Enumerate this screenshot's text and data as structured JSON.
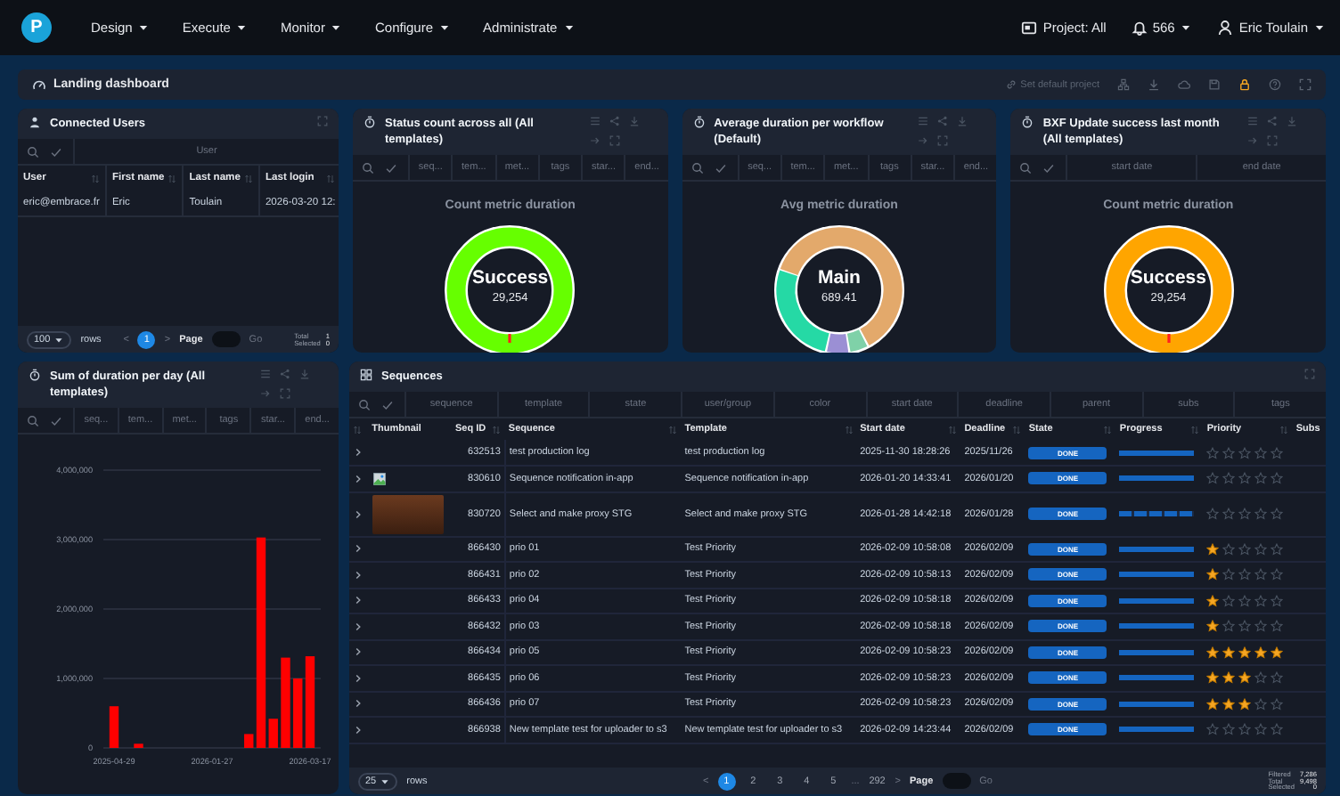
{
  "nav": {
    "logo": "P",
    "menus": [
      {
        "label": "Design"
      },
      {
        "label": "Execute"
      },
      {
        "label": "Monitor"
      },
      {
        "label": "Configure"
      },
      {
        "label": "Administrate"
      }
    ],
    "project": "Project: All",
    "notifications": "566",
    "user": "Eric Toulain"
  },
  "dashboard": {
    "title": "Landing dashboard",
    "set_default": "Set default project"
  },
  "connected_users": {
    "title": "Connected Users",
    "filters": [
      "User"
    ],
    "columns": [
      "User",
      "First name",
      "Last name",
      "Last login"
    ],
    "rows": [
      [
        "eric@embrace.fr",
        "Eric",
        "Toulain",
        "2026-03-20 12:"
      ]
    ],
    "footer": {
      "rows_per_page": "100",
      "rows_label": "rows",
      "prev": "<",
      "pages": [
        {
          "label": "1",
          "selected": true
        }
      ],
      "next": ">",
      "page_label": "Page",
      "go": "Go",
      "totals": [
        {
          "label": "Total",
          "value": "1"
        },
        {
          "label": "Selected",
          "value": "0"
        }
      ]
    }
  },
  "donut_widgets": [
    {
      "title": "Status count across all (All templates)",
      "filters": [
        "seq...",
        "tem...",
        "met...",
        "tags",
        "star...",
        "end..."
      ],
      "chart_title": "Count metric duration",
      "center_label": "Success",
      "center_value": "29,254",
      "kind": "single",
      "color": "#66ff00"
    },
    {
      "title": "Average duration per workflow (Default)",
      "filters": [
        "seq...",
        "tem...",
        "met...",
        "tags",
        "star...",
        "end..."
      ],
      "chart_title": "Avg metric duration",
      "center_label": "Main",
      "center_value": "689.41",
      "kind": "multi"
    },
    {
      "title": "BXF Update success last month (All templates)",
      "filters": [
        "start date",
        "end date"
      ],
      "chart_title": "Count metric duration",
      "center_label": "Success",
      "center_value": "29,254",
      "kind": "single",
      "color": "#ffa500"
    }
  ],
  "sum_widget": {
    "title": "Sum of duration per day (All templates)",
    "filters": [
      "seq...",
      "tem...",
      "met...",
      "tags",
      "star...",
      "end..."
    ],
    "chart_data": {
      "type": "bar",
      "categories": [
        "2025-04-29",
        null,
        null,
        null,
        null,
        null,
        null,
        null,
        "2026-01-27",
        null,
        null,
        null,
        null,
        null,
        null,
        null,
        "2026-03-17"
      ],
      "series": [
        {
          "color": "#ff0000",
          "values": [
            600000,
            null,
            60000,
            null,
            null,
            null,
            null,
            null,
            null,
            null,
            null,
            200000,
            3030000,
            420000,
            1300000,
            1000000,
            1320000
          ]
        }
      ],
      "ylim": [
        0,
        4000000
      ],
      "grid": true,
      "yticks": [
        {
          "value": 0,
          "label": "0"
        },
        {
          "value": 1000000,
          "label": "1,000,000"
        },
        {
          "value": 2000000,
          "label": "2,000,000"
        },
        {
          "value": 3000000,
          "label": "3,000,000"
        },
        {
          "value": 4000000,
          "label": "4,000,000"
        }
      ]
    }
  },
  "sequences": {
    "title": "Sequences",
    "filters": [
      "sequence",
      "template",
      "state",
      "user/group",
      "color",
      "start date",
      "deadline",
      "parent",
      "subs",
      "tags"
    ],
    "columns": [
      "Thumbnail",
      "Seq ID",
      "Sequence",
      "Template",
      "Start date",
      "Deadline",
      "State",
      "Progress",
      "Priority",
      "Subs"
    ],
    "rows": [
      {
        "thumbnail": {
          "kind": "none"
        },
        "seq_id": "632513",
        "sequence": "test production log",
        "template": "test production log",
        "start_date": "2025-11-30 18:28:26",
        "deadline": "2025/11/26",
        "state": "DONE",
        "progress": {
          "level": 1,
          "segmented": false
        },
        "stars": 0
      },
      {
        "thumbnail": {
          "kind": "broken"
        },
        "seq_id": "830610",
        "sequence": "Sequence notification in-app",
        "template": "Sequence notification in-app",
        "start_date": "2026-01-20 14:33:41",
        "deadline": "2026/01/20",
        "state": "DONE",
        "progress": {
          "level": 1,
          "segmented": false
        },
        "stars": 0
      },
      {
        "thumbnail": {
          "kind": "photo"
        },
        "seq_id": "830720",
        "sequence": "Select and make proxy STG",
        "template": "Select and make proxy STG",
        "start_date": "2026-01-28 14:42:18",
        "deadline": "2026/01/28",
        "state": "DONE",
        "progress": {
          "level": 1,
          "segmented": true
        },
        "stars": 0
      },
      {
        "thumbnail": {
          "kind": "none"
        },
        "seq_id": "866430",
        "sequence": "prio 01",
        "template": "Test Priority",
        "start_date": "2026-02-09 10:58:08",
        "deadline": "2026/02/09",
        "state": "DONE",
        "progress": {
          "level": 1,
          "segmented": false
        },
        "stars": 1
      },
      {
        "thumbnail": {
          "kind": "none"
        },
        "seq_id": "866431",
        "sequence": "prio 02",
        "template": "Test Priority",
        "start_date": "2026-02-09 10:58:13",
        "deadline": "2026/02/09",
        "state": "DONE",
        "progress": {
          "level": 1,
          "segmented": false
        },
        "stars": 1
      },
      {
        "thumbnail": {
          "kind": "none"
        },
        "seq_id": "866433",
        "sequence": "prio 04",
        "template": "Test Priority",
        "start_date": "2026-02-09 10:58:18",
        "deadline": "2026/02/09",
        "state": "DONE",
        "progress": {
          "level": 1,
          "segmented": false
        },
        "stars": 1
      },
      {
        "thumbnail": {
          "kind": "none"
        },
        "seq_id": "866432",
        "sequence": "prio 03",
        "template": "Test Priority",
        "start_date": "2026-02-09 10:58:18",
        "deadline": "2026/02/09",
        "state": "DONE",
        "progress": {
          "level": 1,
          "segmented": false
        },
        "stars": 1
      },
      {
        "thumbnail": {
          "kind": "none"
        },
        "seq_id": "866434",
        "sequence": "prio 05",
        "template": "Test Priority",
        "start_date": "2026-02-09 10:58:23",
        "deadline": "2026/02/09",
        "state": "DONE",
        "progress": {
          "level": 1,
          "segmented": false
        },
        "stars": 5
      },
      {
        "thumbnail": {
          "kind": "none"
        },
        "seq_id": "866435",
        "sequence": "prio 06",
        "template": "Test Priority",
        "start_date": "2026-02-09 10:58:23",
        "deadline": "2026/02/09",
        "state": "DONE",
        "progress": {
          "level": 1,
          "segmented": false
        },
        "stars": 3
      },
      {
        "thumbnail": {
          "kind": "none"
        },
        "seq_id": "866436",
        "sequence": "prio 07",
        "template": "Test Priority",
        "start_date": "2026-02-09 10:58:23",
        "deadline": "2026/02/09",
        "state": "DONE",
        "progress": {
          "level": 1,
          "segmented": false
        },
        "stars": 3
      },
      {
        "thumbnail": {
          "kind": "none"
        },
        "seq_id": "866938",
        "sequence": "New template test for uploader to s3",
        "template": "New template test for uploader to s3",
        "start_date": "2026-02-09 14:23:44",
        "deadline": "2026/02/09",
        "state": "DONE",
        "progress": {
          "level": 1,
          "segmented": false
        },
        "stars": 0
      }
    ],
    "footer": {
      "rows_per_page": "25",
      "rows_label": "rows",
      "prev": "<",
      "pages": [
        {
          "label": "1",
          "selected": true
        },
        {
          "label": "2",
          "selected": false
        },
        {
          "label": "3",
          "selected": false
        },
        {
          "label": "4",
          "selected": false
        },
        {
          "label": "5",
          "selected": false
        },
        {
          "label": "292",
          "selected": false
        }
      ],
      "ellipsis": "...",
      "next": ">",
      "page_label": "Page",
      "go": "Go",
      "totals": [
        {
          "label": "Filtered",
          "value": "7,286"
        },
        {
          "label": "Total",
          "value": "9,498"
        },
        {
          "label": "Selected",
          "value": "0"
        }
      ]
    }
  }
}
